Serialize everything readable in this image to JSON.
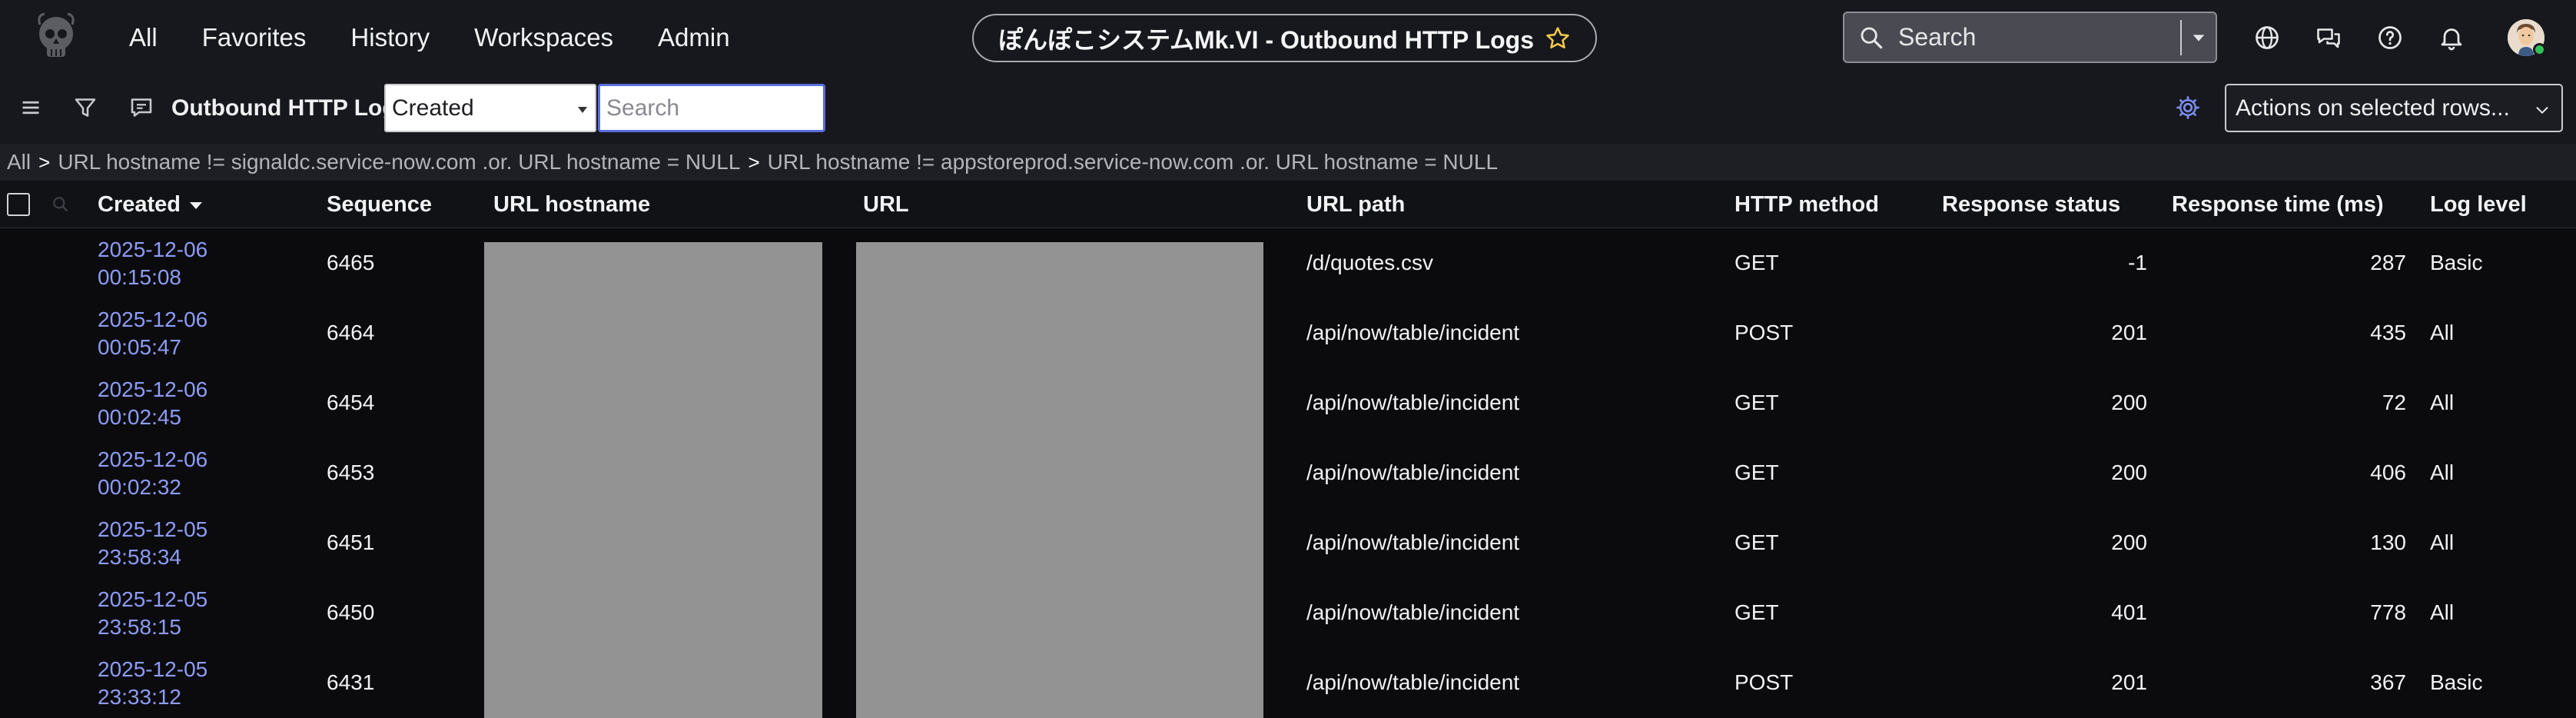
{
  "nav": {
    "items": [
      "All",
      "Favorites",
      "History",
      "Workspaces",
      "Admin"
    ],
    "title": "ぽんぽこシステムMk.VI - Outbound HTTP Logs",
    "search_label": "Search",
    "icons": [
      "globe-icon",
      "chat-icon",
      "help-icon",
      "bell-icon"
    ]
  },
  "toolbar": {
    "list_title": "Outbound HTTP Logs",
    "field_selected": "Created",
    "search_placeholder": "Search",
    "actions_label": "Actions on selected rows..."
  },
  "breadcrumb": {
    "items": [
      "All",
      "URL hostname != signaldc.service-now.com .or. URL hostname = NULL",
      "URL hostname != appstoreprod.service-now.com .or. URL hostname = NULL"
    ],
    "separator": ">"
  },
  "table": {
    "columns": [
      "Created",
      "Sequence",
      "URL hostname",
      "URL",
      "URL path",
      "HTTP method",
      "Response status",
      "Response time (ms)",
      "Log level"
    ],
    "rows": [
      {
        "date": "2025-12-06",
        "time": "00:15:08",
        "sequence": "6465",
        "url_path": "/d/quotes.csv",
        "method": "GET",
        "status": "-1",
        "response_time": "287",
        "log_level": "Basic"
      },
      {
        "date": "2025-12-06",
        "time": "00:05:47",
        "sequence": "6464",
        "url_path": "/api/now/table/incident",
        "method": "POST",
        "status": "201",
        "response_time": "435",
        "log_level": "All"
      },
      {
        "date": "2025-12-06",
        "time": "00:02:45",
        "sequence": "6454",
        "url_path": "/api/now/table/incident",
        "method": "GET",
        "status": "200",
        "response_time": "72",
        "log_level": "All"
      },
      {
        "date": "2025-12-06",
        "time": "00:02:32",
        "sequence": "6453",
        "url_path": "/api/now/table/incident",
        "method": "GET",
        "status": "200",
        "response_time": "406",
        "log_level": "All"
      },
      {
        "date": "2025-12-05",
        "time": "23:58:34",
        "sequence": "6451",
        "url_path": "/api/now/table/incident",
        "method": "GET",
        "status": "200",
        "response_time": "130",
        "log_level": "All"
      },
      {
        "date": "2025-12-05",
        "time": "23:58:15",
        "sequence": "6450",
        "url_path": "/api/now/table/incident",
        "method": "GET",
        "status": "401",
        "response_time": "778",
        "log_level": "All"
      },
      {
        "date": "2025-12-05",
        "time": "23:33:12",
        "sequence": "6431",
        "url_path": "/api/now/table/incident",
        "method": "POST",
        "status": "201",
        "response_time": "367",
        "log_level": "Basic"
      }
    ]
  },
  "colors": {
    "link": "#8d9cf5",
    "nav_bg": "#17181d",
    "table_bg": "#0b0b0d",
    "redaction": "#939393",
    "focus_border": "#5b6ee0"
  }
}
